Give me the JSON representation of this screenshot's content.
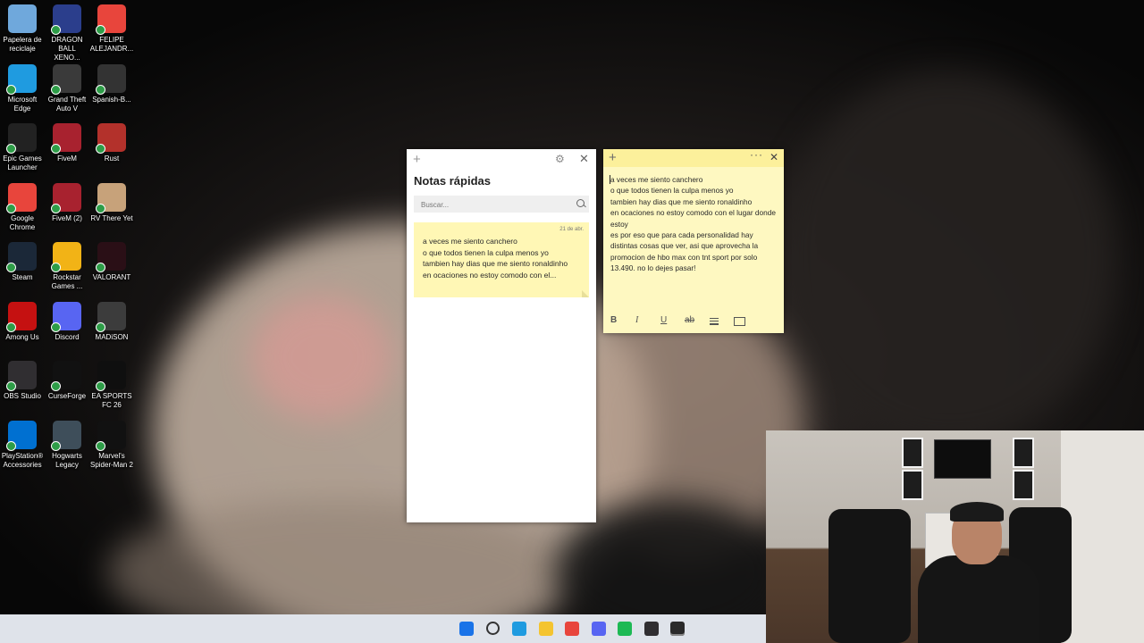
{
  "desktop": {
    "icons": [
      {
        "label": "Papelera de reciclaje",
        "icon": "recycle-bin-icon",
        "color": "#6fa8dc"
      },
      {
        "label": "DRAGON BALL XENO...",
        "icon": "dragon-ball-icon",
        "color": "#2b3e8c"
      },
      {
        "label": "FELIPE ALEJANDR...",
        "icon": "chrome-profile-icon",
        "color": "#e8453c"
      },
      {
        "label": "Microsoft Edge",
        "icon": "edge-icon",
        "color": "#1f9be0"
      },
      {
        "label": "Grand Theft Auto V",
        "icon": "gta-icon",
        "color": "#3a3a3a"
      },
      {
        "label": "Spanish-B...",
        "icon": "folder-shortcut-icon",
        "color": "#333333"
      },
      {
        "label": "Epic Games Launcher",
        "icon": "epic-games-icon",
        "color": "#222222"
      },
      {
        "label": "FiveM",
        "icon": "fivem-icon",
        "color": "#a8222f"
      },
      {
        "label": "Rust",
        "icon": "rust-icon",
        "color": "#b3312b"
      },
      {
        "label": "Google Chrome",
        "icon": "chrome-icon",
        "color": "#e8453c"
      },
      {
        "label": "FiveM (2)",
        "icon": "fivem-icon",
        "color": "#a8222f"
      },
      {
        "label": "RV There Yet",
        "icon": "rv-there-yet-icon",
        "color": "#c7a27a"
      },
      {
        "label": "Steam",
        "icon": "steam-icon",
        "color": "#1b2838"
      },
      {
        "label": "Rockstar Games ...",
        "icon": "rockstar-icon",
        "color": "#f2b316"
      },
      {
        "label": "VALORANT",
        "icon": "valorant-icon",
        "color": "#2a0f16"
      },
      {
        "label": "Among Us",
        "icon": "among-us-icon",
        "color": "#c51111"
      },
      {
        "label": "Discord",
        "icon": "discord-icon",
        "color": "#5865f2"
      },
      {
        "label": "MADiSON",
        "icon": "madison-icon",
        "color": "#3c3c3c"
      },
      {
        "label": "OBS Studio",
        "icon": "obs-icon",
        "color": "#302e31"
      },
      {
        "label": "CurseForge",
        "icon": "curseforge-icon",
        "color": "#111111"
      },
      {
        "label": "EA SPORTS FC 26",
        "icon": "ea-fc-icon",
        "color": "#0f0f0f"
      },
      {
        "label": "PlayStation® Accessories",
        "icon": "playstation-icon",
        "color": "#0070d1"
      },
      {
        "label": "Hogwarts Legacy",
        "icon": "hogwarts-icon",
        "color": "#3e4e5a"
      },
      {
        "label": "Marvel's Spider-Man 2",
        "icon": "spider-man-icon",
        "color": "#111111"
      }
    ]
  },
  "notes_list": {
    "title": "Notas rápidas",
    "search_placeholder": "Buscar...",
    "note": {
      "date": "21 de abr.",
      "preview": "a veces me siento canchero\no que todos tienen la culpa menos yo\ntambien hay dias que me siento ronaldinho\nen ocaciones no estoy comodo con el..."
    }
  },
  "sticky_note": {
    "body": "a veces me siento canchero\no que todos tienen la culpa menos yo\ntambien hay dias que me siento ronaldinho\nen ocaciones no estoy comodo con el lugar donde estoy\nes por eso que para cada personalidad hay distintas cosas que ver, asi que aprovecha la promocion de hbo max con tnt sport por solo 13.490. no lo dejes pasar!",
    "toolbar": {
      "bold": "B",
      "italic": "I",
      "underline": "U",
      "strike": "ab"
    }
  },
  "taskbar": {
    "items": [
      {
        "name": "start-icon",
        "color": "#1a73e8"
      },
      {
        "name": "search-icon",
        "color": "#333333"
      },
      {
        "name": "edge-icon",
        "color": "#1f9be0"
      },
      {
        "name": "file-explorer-icon",
        "color": "#f4c430"
      },
      {
        "name": "chrome-icon",
        "color": "#e8453c"
      },
      {
        "name": "discord-icon",
        "color": "#5865f2"
      },
      {
        "name": "spotify-icon",
        "color": "#1db954"
      },
      {
        "name": "obs-icon",
        "color": "#302e31"
      },
      {
        "name": "sticky-notes-icon",
        "color": "#2a2a2a"
      }
    ]
  }
}
